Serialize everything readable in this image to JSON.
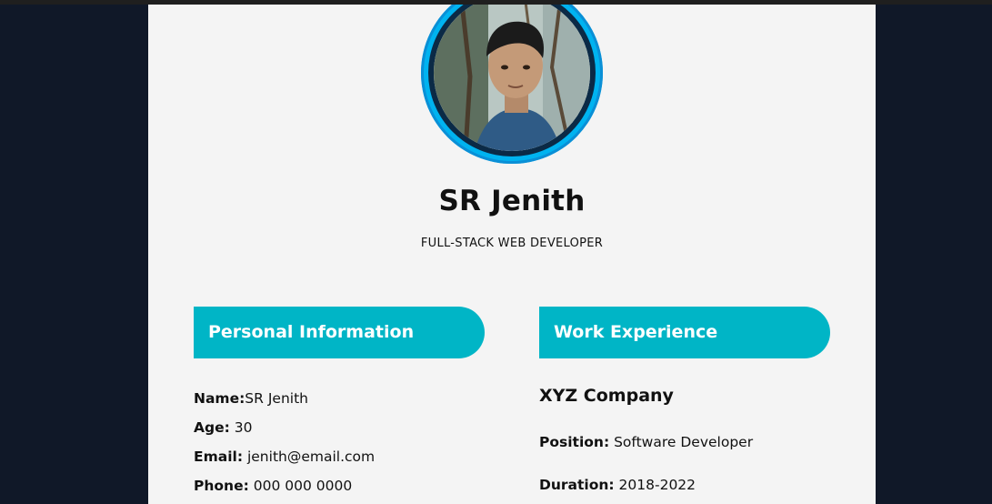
{
  "profile": {
    "name": "SR Jenith",
    "title": "FULL-STACK WEB DEVELOPER"
  },
  "personal": {
    "heading": "Personal Information",
    "name_label": "Name:",
    "name_value": "SR Jenith",
    "age_label": "Age:",
    "age_value": "30",
    "email_label": "Email:",
    "email_value": "jenith@email.com",
    "phone_label": "Phone:",
    "phone_value": "000 000 0000"
  },
  "work": {
    "heading": "Work Experience",
    "company": "XYZ Company",
    "position_label": "Position:",
    "position_value": "Software Developer",
    "duration_label": "Duration:",
    "duration_value": "2018-2022"
  },
  "colors": {
    "page_background": "#101828",
    "card_background": "#f4f4f4",
    "section_header": "#00b5c6",
    "avatar_ring": "#00b3f0"
  }
}
